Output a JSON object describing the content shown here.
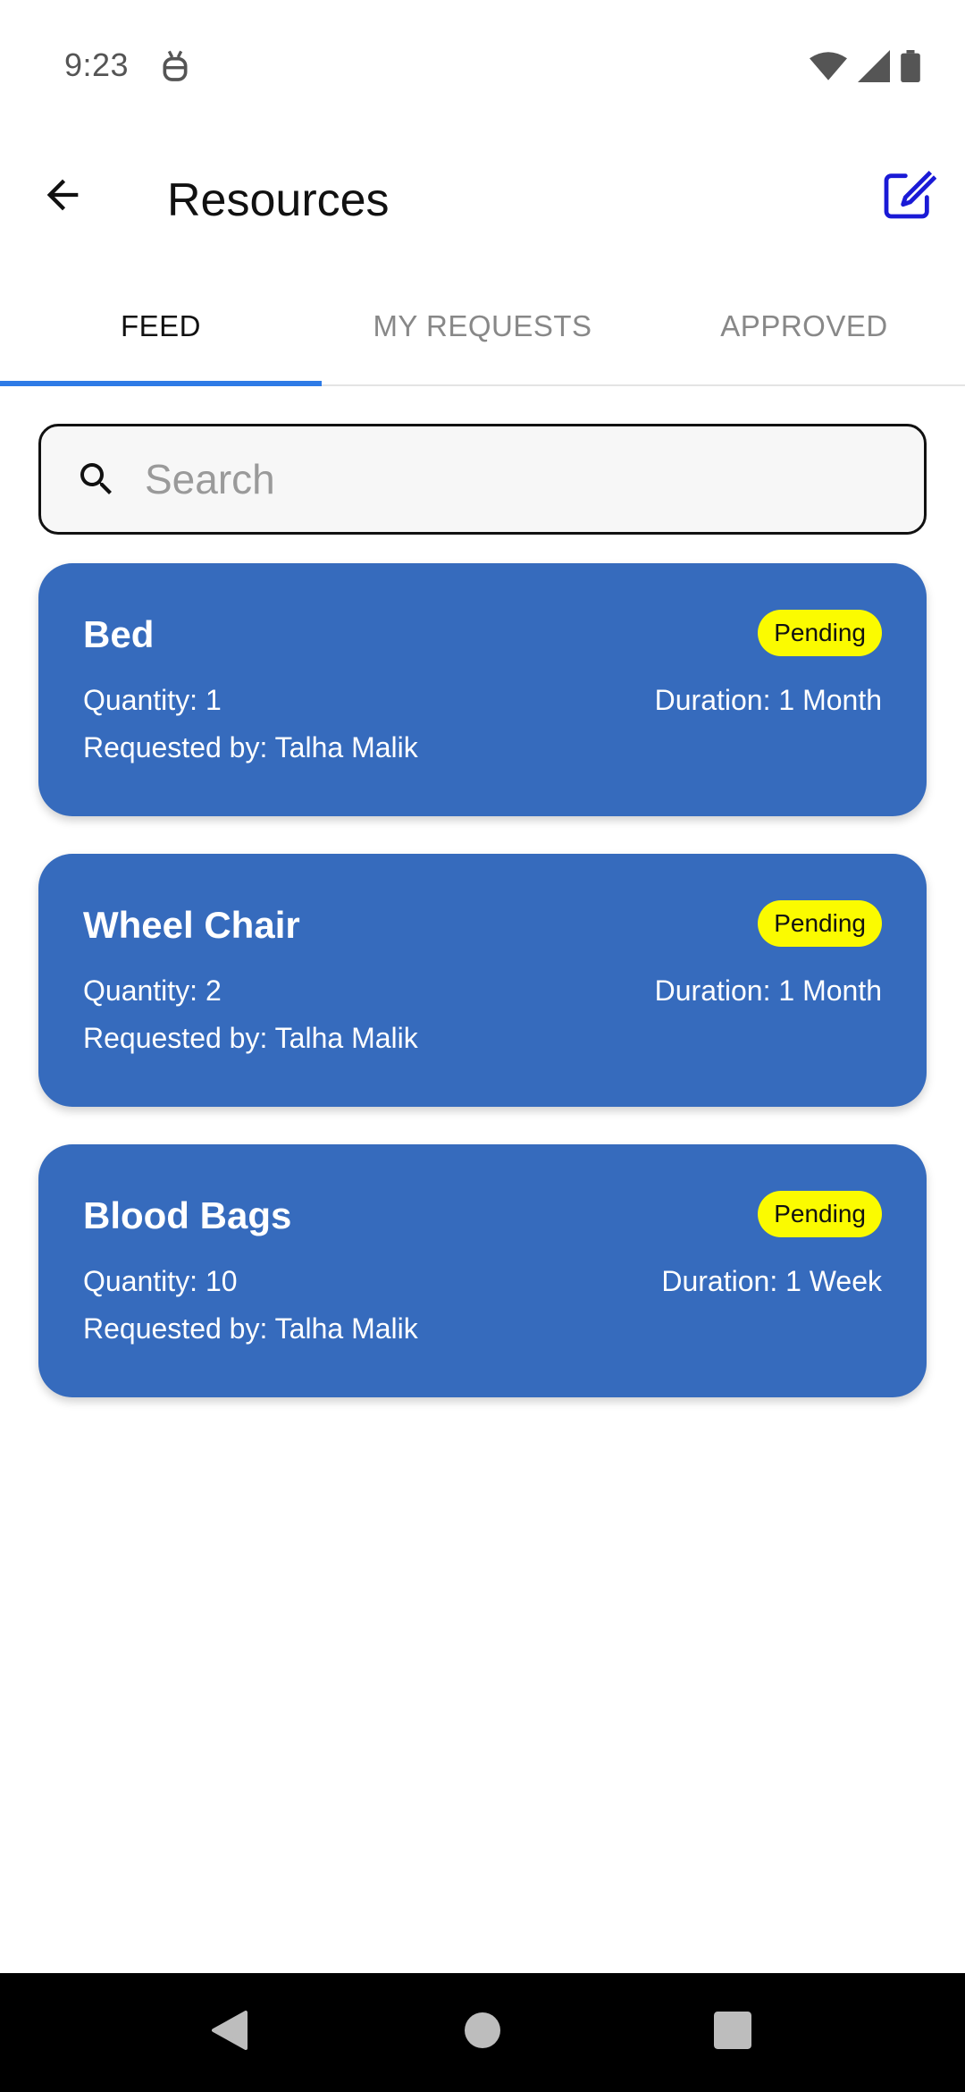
{
  "status_bar": {
    "time": "9:23"
  },
  "app_bar": {
    "title": "Resources"
  },
  "tabs": [
    {
      "label": "FEED",
      "active": true
    },
    {
      "label": "MY REQUESTS",
      "active": false
    },
    {
      "label": "APPROVED",
      "active": false
    }
  ],
  "search": {
    "placeholder": "Search",
    "value": ""
  },
  "cards": [
    {
      "title": "Bed",
      "status": "Pending",
      "quantity": "Quantity: 1",
      "duration": "Duration: 1 Month",
      "requested_by": "Requested by: Talha Malik"
    },
    {
      "title": "Wheel Chair",
      "status": "Pending",
      "quantity": "Quantity: 2",
      "duration": "Duration: 1 Month",
      "requested_by": "Requested by: Talha Malik"
    },
    {
      "title": "Blood Bags",
      "status": "Pending",
      "quantity": "Quantity: 10",
      "duration": "Duration: 1 Week",
      "requested_by": "Requested by: Talha Malik"
    }
  ],
  "colors": {
    "card_background": "#366bbd",
    "badge_background": "#fbfb00",
    "tab_indicator": "#2e7be6",
    "edit_icon": "#1a1ad6"
  },
  "icons": {
    "back": "arrow-back-icon",
    "edit": "edit-square-icon",
    "search": "search-icon",
    "nav_back": "nav-back-triangle-icon",
    "nav_home": "nav-home-circle-icon",
    "nav_recents": "nav-recents-square-icon"
  }
}
